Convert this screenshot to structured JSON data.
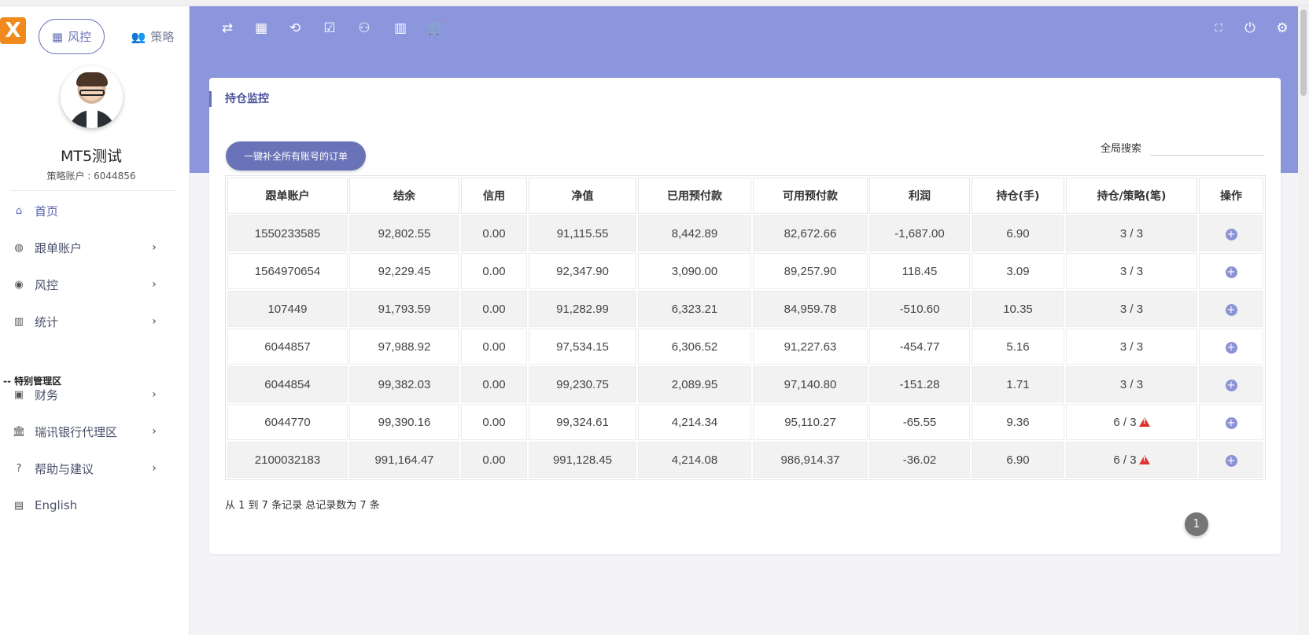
{
  "topnav": {
    "tab_risk": "风控",
    "tab_strategy": "策略"
  },
  "profile": {
    "name": "MT5测试",
    "account_line": "策略账户 : 6044856"
  },
  "sidebar": {
    "items": [
      {
        "label": "首页",
        "icon": "home-icon",
        "has_arrow": false
      },
      {
        "label": "跟单账户",
        "icon": "globe-icon",
        "has_arrow": true
      },
      {
        "label": "风控",
        "icon": "palette-icon",
        "has_arrow": true
      },
      {
        "label": "统计",
        "icon": "bar-chart-icon",
        "has_arrow": true
      },
      {
        "label": "财务",
        "icon": "wallet-icon",
        "has_arrow": true
      },
      {
        "label": "瑞讯银行代理区",
        "icon": "bank-icon",
        "has_arrow": true
      },
      {
        "label": "帮助与建议",
        "icon": "help-circle-icon",
        "has_arrow": true
      },
      {
        "label": "English",
        "icon": "keyboard-icon",
        "has_arrow": false
      }
    ],
    "section_label": "-- 特别管理区"
  },
  "toolbar_icons": [
    "swap-icon",
    "dashboard-icon",
    "repeat-icon",
    "clipboard-check-icon",
    "users-icon",
    "report-icon",
    "cart-icon"
  ],
  "toolbar_right_icons": [
    "fullscreen-icon",
    "power-icon",
    "settings-icon"
  ],
  "card": {
    "title": "持仓监控",
    "fill_button": "一键补全所有账号的订单",
    "search_label": "全局搜索",
    "search_value": ""
  },
  "table": {
    "headers": [
      "跟单账户",
      "结余",
      "信用",
      "净值",
      "已用预付款",
      "可用预付款",
      "利润",
      "持仓(手)",
      "持仓/策略(笔)",
      "操作"
    ],
    "rows": [
      {
        "account": "1550233585",
        "balance": "92,802.55",
        "credit": "0.00",
        "equity": "91,115.55",
        "used_margin": "8,442.89",
        "free_margin": "82,672.66",
        "profit": "-1,687.00",
        "lots": "6.90",
        "ratio": "3 / 3",
        "warning": false
      },
      {
        "account": "1564970654",
        "balance": "92,229.45",
        "credit": "0.00",
        "equity": "92,347.90",
        "used_margin": "3,090.00",
        "free_margin": "89,257.90",
        "profit": "118.45",
        "lots": "3.09",
        "ratio": "3 / 3",
        "warning": false
      },
      {
        "account": "107449",
        "balance": "91,793.59",
        "credit": "0.00",
        "equity": "91,282.99",
        "used_margin": "6,323.21",
        "free_margin": "84,959.78",
        "profit": "-510.60",
        "lots": "10.35",
        "ratio": "3 / 3",
        "warning": false
      },
      {
        "account": "6044857",
        "balance": "97,988.92",
        "credit": "0.00",
        "equity": "97,534.15",
        "used_margin": "6,306.52",
        "free_margin": "91,227.63",
        "profit": "-454.77",
        "lots": "5.16",
        "ratio": "3 / 3",
        "warning": false
      },
      {
        "account": "6044854",
        "balance": "99,382.03",
        "credit": "0.00",
        "equity": "99,230.75",
        "used_margin": "2,089.95",
        "free_margin": "97,140.80",
        "profit": "-151.28",
        "lots": "1.71",
        "ratio": "3 / 3",
        "warning": false
      },
      {
        "account": "6044770",
        "balance": "99,390.16",
        "credit": "0.00",
        "equity": "99,324.61",
        "used_margin": "4,214.34",
        "free_margin": "95,110.27",
        "profit": "-65.55",
        "lots": "9.36",
        "ratio": "6 / 3",
        "warning": true
      },
      {
        "account": "2100032183",
        "balance": "991,164.47",
        "credit": "0.00",
        "equity": "991,128.45",
        "used_margin": "4,214.08",
        "free_margin": "986,914.37",
        "profit": "-36.02",
        "lots": "6.90",
        "ratio": "6 / 3",
        "warning": true
      }
    ]
  },
  "footer": {
    "records_text": "从 1 到 7 条记录 总记录数为 7 条",
    "current_page": "1"
  },
  "colors": {
    "accent": "#6a73b8",
    "topbar": "#8b96dd",
    "warning": "#e03131"
  }
}
